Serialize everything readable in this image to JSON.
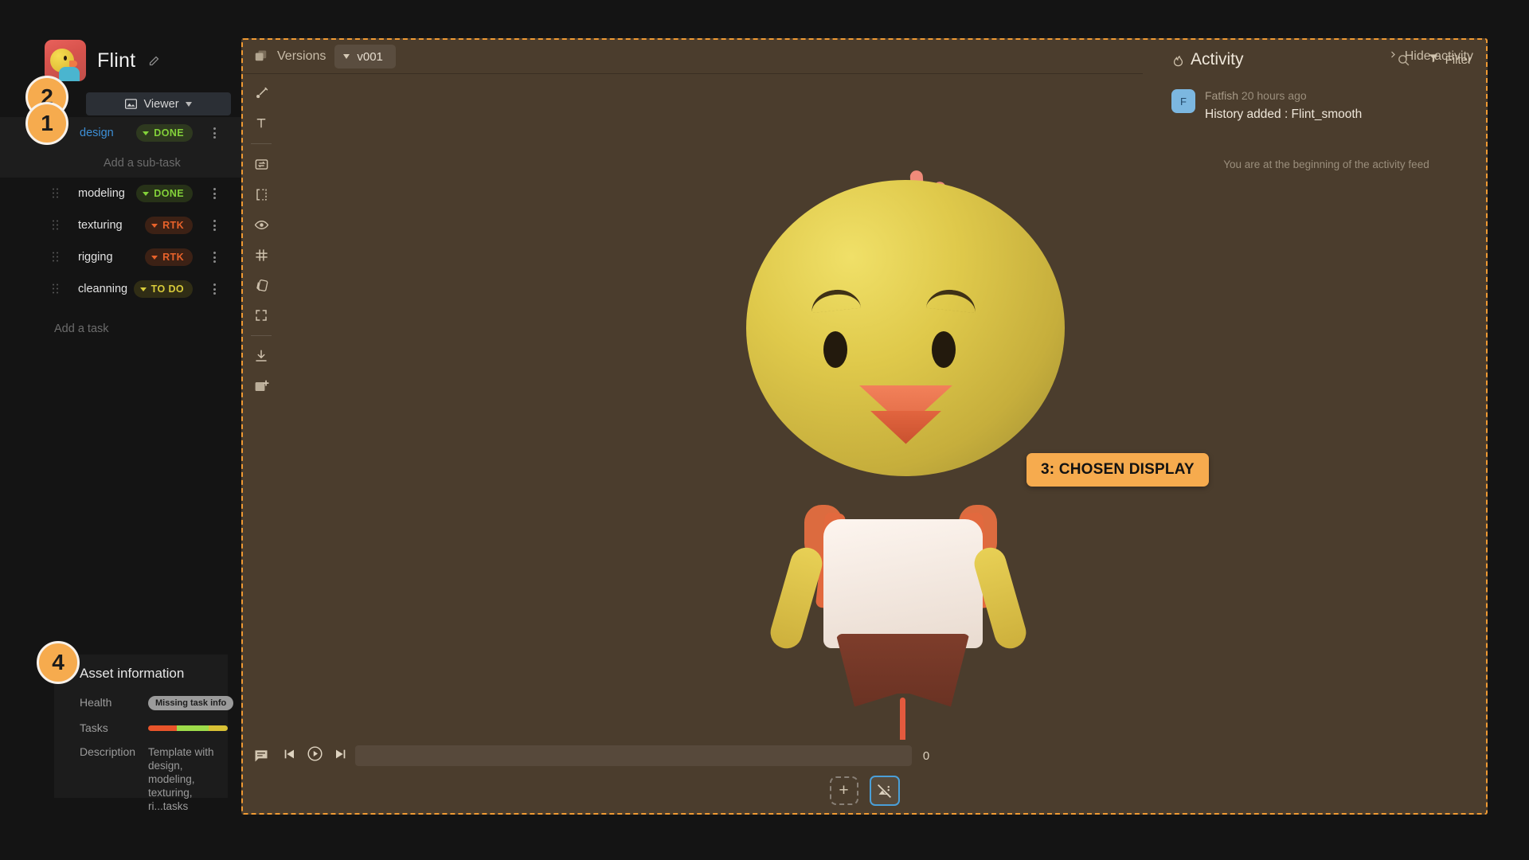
{
  "brand": {
    "name": "Flint",
    "edit_icon": "pencil-icon",
    "thumbnail_icon": "asset-thumbnail"
  },
  "sidebar": {
    "viewer_selector": {
      "label": "Viewer",
      "icon": "image-icon",
      "caret": "chevron-down-icon"
    },
    "tasks": [
      {
        "name": "design",
        "status": "DONE",
        "status_kind": "done",
        "selected": true,
        "has_grip": false
      },
      {
        "name": "modeling",
        "status": "DONE",
        "status_kind": "done",
        "selected": false,
        "has_grip": true
      },
      {
        "name": "texturing",
        "status": "RTK",
        "status_kind": "rtk",
        "selected": false,
        "has_grip": true
      },
      {
        "name": "rigging",
        "status": "RTK",
        "status_kind": "rtk",
        "selected": false,
        "has_grip": true
      },
      {
        "name": "cleanning",
        "status": "TO DO",
        "status_kind": "todo",
        "selected": false,
        "has_grip": true
      }
    ],
    "add_sub_task": "Add a sub-task",
    "add_task": "Add a task"
  },
  "asset_info": {
    "title": "Asset information",
    "health_label": "Health",
    "health_value": "Missing task info",
    "tasks_label": "Tasks",
    "tasks_segments": [
      {
        "color": "#e8542a",
        "pct": 36
      },
      {
        "color": "#9ddc4a",
        "pct": 40
      },
      {
        "color": "#d8c135",
        "pct": 24
      }
    ],
    "description_label": "Description",
    "description_value": "Template with design, modeling, texturing, ri...tasks"
  },
  "markers": [
    {
      "id": "1",
      "label": "1"
    },
    {
      "id": "2",
      "label": "2"
    },
    {
      "id": "4",
      "label": "4"
    }
  ],
  "viewer": {
    "versions_label": "Versions",
    "versions_icon": "versions-icon",
    "selected_version": "v001",
    "hide_activity": "Hide activity",
    "chevron_icon": "chevron-right-icon",
    "tools": [
      {
        "name": "annotate-brush-tool",
        "icon": "brush-icon"
      },
      {
        "name": "text-tool",
        "icon": "text-icon"
      },
      {
        "name": "compare-tool",
        "icon": "compare-icon"
      },
      {
        "name": "split-view-tool",
        "icon": "split-icon"
      },
      {
        "name": "visibility-tool",
        "icon": "eye-icon"
      },
      {
        "name": "grid-overlay-tool",
        "icon": "grid-icon"
      },
      {
        "name": "color-swatch-tool",
        "icon": "swatch-icon"
      },
      {
        "name": "fullscreen-tool",
        "icon": "fullscreen-icon"
      },
      {
        "name": "download-tool",
        "icon": "download-icon"
      },
      {
        "name": "add-media-tool",
        "icon": "image-plus-icon"
      }
    ],
    "callout": "3: CHOSEN DISPLAY",
    "playback": {
      "comment_icon": "comment-icon",
      "skip_start_icon": "skip-to-start-icon",
      "play_icon": "play-icon",
      "skip_end_icon": "skip-to-end-icon",
      "frame": "0"
    },
    "bottom_tools": {
      "add_label": "+",
      "add_icon": "add-media-placeholder-icon",
      "thumb_icon": "no-image-icon"
    }
  },
  "activity": {
    "title": "Activity",
    "flame_icon": "flame-icon",
    "search_icon": "search-icon",
    "filter_label": "Filter",
    "filter_icon": "filter-icon",
    "items": [
      {
        "avatar_initial": "F",
        "author": "Fatfish",
        "time": "20 hours ago",
        "body": "History added : Flint_smooth"
      }
    ],
    "feed_end": "You are at the beginning of the activity feed"
  }
}
